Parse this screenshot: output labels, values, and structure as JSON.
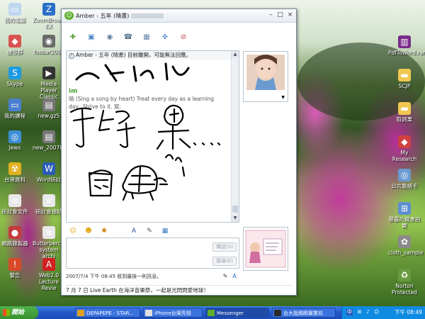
{
  "desktop": {
    "icons_left": [
      {
        "label": "我的電腦",
        "icon": "computer-icon",
        "color": "#c0d6ef",
        "glyph": "▭"
      },
      {
        "label": "捷徑群",
        "icon": "shortcut-folder-icon",
        "color": "#d9534f",
        "glyph": "◆"
      },
      {
        "label": "Skype",
        "icon": "skype-icon",
        "color": "#1e9be0",
        "glyph": "S"
      },
      {
        "label": "我的課程",
        "icon": "monitor-icon",
        "color": "#4a7fd0",
        "glyph": "▭"
      },
      {
        "label": "Jews",
        "icon": "globe-icon",
        "color": "#3e8fd6",
        "glyph": "◎"
      },
      {
        "label": "台灣資料",
        "icon": "radiation-icon",
        "color": "#e0b020",
        "glyph": "☢"
      },
      {
        "label": "研討會文件",
        "icon": "document-icon",
        "color": "#e8e8e8",
        "glyph": "≡"
      },
      {
        "label": "網路錄製器",
        "icon": "recorder-icon",
        "color": "#c43a3a",
        "glyph": "●"
      },
      {
        "label": "警告",
        "icon": "warning-icon",
        "color": "#d94a2a",
        "glyph": "!"
      }
    ],
    "icons_mid": [
      {
        "label": "ZoomBrowser EX",
        "icon": "zoombrowser-icon",
        "color": "#2c6fc8",
        "glyph": "Z"
      },
      {
        "label": "foobar2000",
        "icon": "foobar-icon",
        "color": "#6a6a6a",
        "glyph": "◉"
      },
      {
        "label": "Media Player Classic",
        "icon": "media-player-icon",
        "color": "#333333",
        "glyph": "▶"
      },
      {
        "label": "new.gz5",
        "icon": "film-icon",
        "color": "#777777",
        "glyph": "▤"
      },
      {
        "label": "new_200705",
        "icon": "film-icon",
        "color": "#777777",
        "glyph": "▤"
      },
      {
        "label": "Word研討",
        "icon": "word-doc-icon",
        "color": "#2b5cb5",
        "glyph": "W"
      },
      {
        "label": "研討會總結",
        "icon": "pdf-icon",
        "color": "#e8e8e8",
        "glyph": "≡"
      },
      {
        "label": "Butterpercent system archi",
        "icon": "pdf-icon",
        "color": "#e8e8e8",
        "glyph": "≡"
      },
      {
        "label": "Web2.0 Lecture Revie",
        "icon": "pdf-icon",
        "color": "#d02020",
        "glyph": "A"
      }
    ],
    "icons_right": [
      {
        "label": "PdfToWord.rar",
        "icon": "rar-archive-icon",
        "color": "#7a2a8a",
        "glyph": "▥"
      },
      {
        "label": "SCJP",
        "icon": "folder-icon",
        "color": "#f0c850",
        "glyph": "▬"
      },
      {
        "label": "取詞果",
        "icon": "folder-icon",
        "color": "#f0c850",
        "glyph": "▬"
      },
      {
        "label": "My Research",
        "icon": "research-icon",
        "color": "#d04040",
        "glyph": "◆"
      },
      {
        "label": "公共聯絡卡",
        "icon": "contact-icon",
        "color": "#6a9ad0",
        "glyph": "◎"
      },
      {
        "label": "暴露的藏書拍賣",
        "icon": "network-icon",
        "color": "#5f8fcf",
        "glyph": "⊞"
      },
      {
        "label": "cloth_sample",
        "icon": "gear-icon",
        "color": "#8a8a8a",
        "glyph": "✿"
      },
      {
        "label": "Norton Protected",
        "icon": "recycle-bin-icon",
        "color": "#6a9a40",
        "glyph": "♻"
      }
    ]
  },
  "window": {
    "title_prefix": "Amber - 五年 (晴書)",
    "btn_min": "–",
    "btn_max": "□",
    "btn_close": "×",
    "toolbar_icons": [
      {
        "name": "invite-icon",
        "glyph": "✚",
        "color": "#5aa03a"
      },
      {
        "name": "send-file-icon",
        "glyph": "▣",
        "color": "#4a88c8"
      },
      {
        "name": "webcam-icon",
        "glyph": "◉",
        "color": "#5a7a9a"
      },
      {
        "name": "call-icon",
        "glyph": "☎",
        "color": "#4a6a8a"
      },
      {
        "name": "activities-icon",
        "glyph": "▦",
        "color": "#6a8aaa"
      },
      {
        "name": "games-icon",
        "glyph": "✜",
        "color": "#4a88c8"
      },
      {
        "name": "block-icon",
        "glyph": "⊘",
        "color": "#c04040"
      }
    ],
    "conversation": {
      "notice": "Amber - 五年 (晴書) 目前離開，可能無法回應。",
      "info_glyph": "i",
      "im_logo": "im",
      "message": "晴 (Sing a song by heart) Treat every day as a learning day...Strive to it. 寫:"
    },
    "emoticon_toolbar": [
      {
        "name": "emoticon-icon",
        "glyph": "☺",
        "color": "#e0a000"
      },
      {
        "name": "wink-icon",
        "glyph": "☻",
        "color": "#e0a000"
      },
      {
        "name": "nudge-icon",
        "glyph": "✱",
        "color": "#d08000"
      },
      {
        "name": "font-icon",
        "glyph": "A",
        "color": "#2050a0"
      },
      {
        "name": "handwriting-icon",
        "glyph": "✎",
        "color": "#404040"
      },
      {
        "name": "background-icon",
        "glyph": "▦",
        "color": "#3a78c0"
      }
    ],
    "send_label": "傳送(S)",
    "search_label": "搜尋(E)",
    "status_text": "2007/7/4 下午 08:45 收到最後一則訊息。",
    "ad_text": "7 月 7 日 Live Earth 在海洋音樂祭，一起是光閃閃愛地球！"
  },
  "taskbar": {
    "start_label": "開始",
    "tasks": [
      {
        "label": "DEPAPEPE - STAR...",
        "icon": "player-icon",
        "color": "#e0a020"
      },
      {
        "label": "iPhone台灣亮相",
        "icon": "browser-icon",
        "color": "#e0e0e0"
      },
      {
        "label": "Messenger",
        "icon": "messenger-icon",
        "color": "#5fae2e",
        "active": true
      },
      {
        "label": "台大批踢踢實業坊",
        "icon": "terminal-icon",
        "color": "#2a2a2a"
      }
    ],
    "tray_lang": "中",
    "clock": "下午 08:49"
  }
}
